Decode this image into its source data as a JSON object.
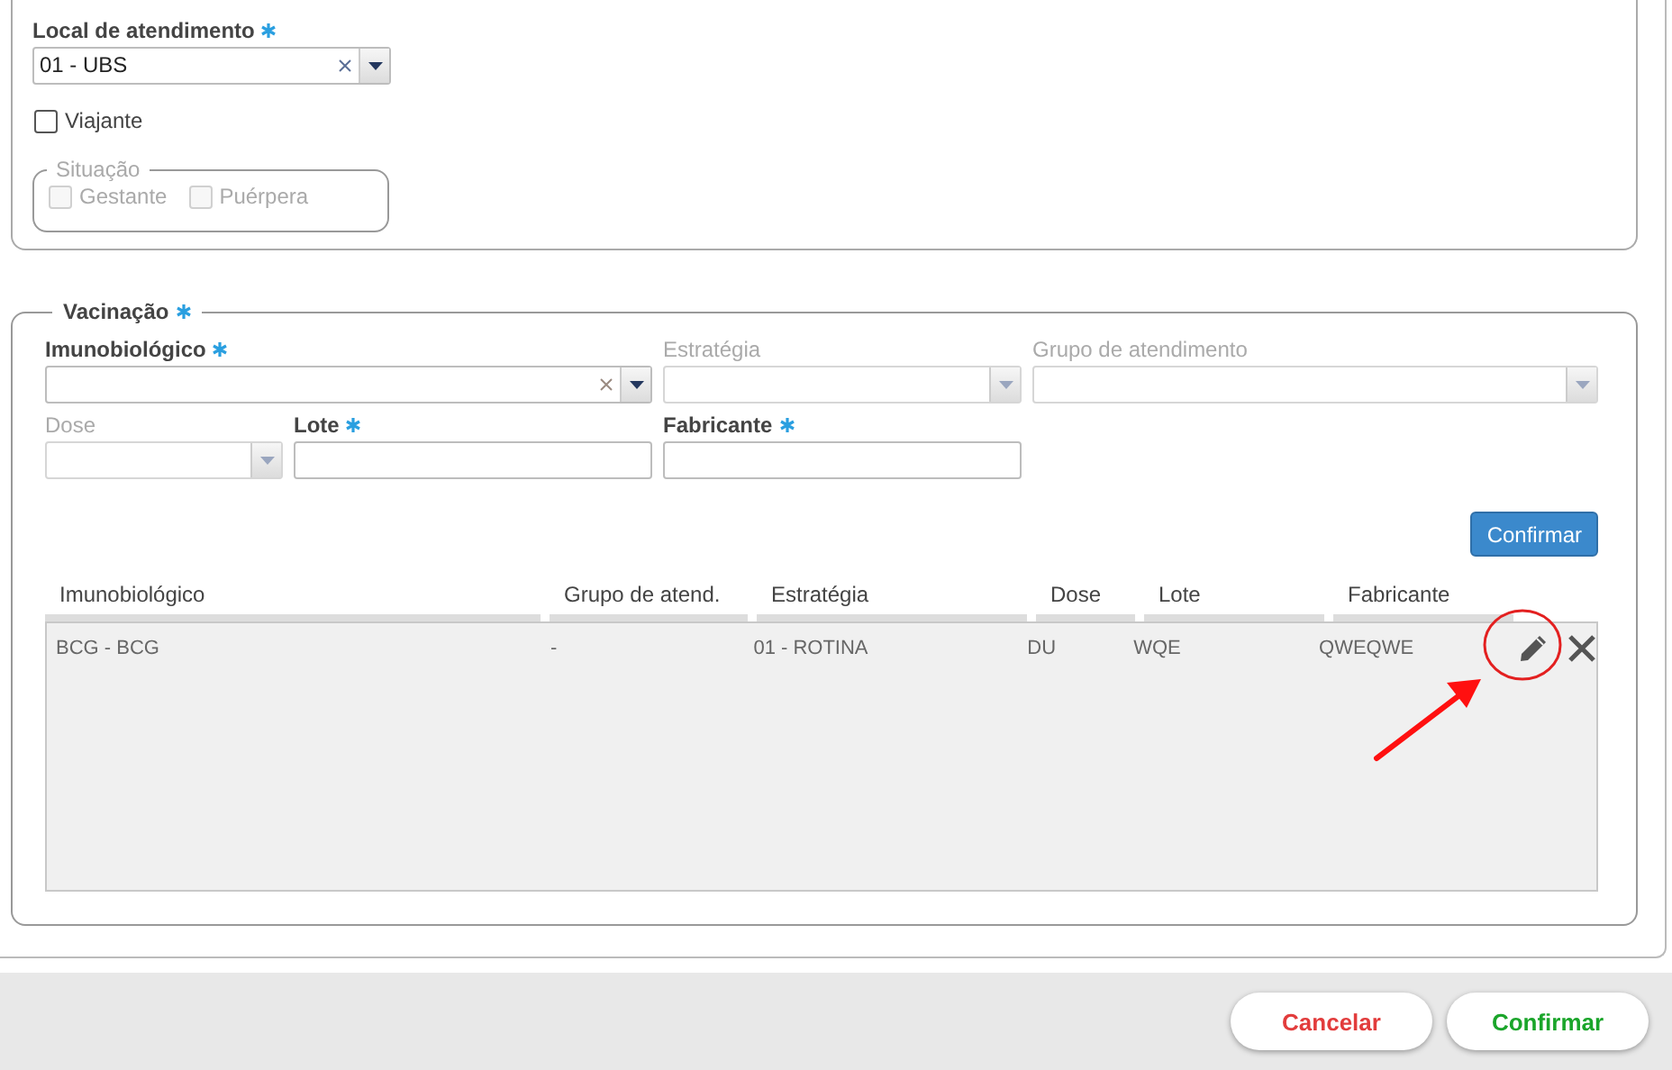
{
  "location_section": {
    "field": {
      "label": "Local de atendimento",
      "required": true,
      "value": "01 - UBS",
      "clearable": true,
      "disabled": false
    },
    "traveler": {
      "label": "Viajante",
      "checked": false,
      "disabled": false
    },
    "situation": {
      "legend": "Situação",
      "options": [
        {
          "label": "Gestante",
          "checked": false,
          "disabled": true
        },
        {
          "label": "Puérpera",
          "checked": false,
          "disabled": true
        }
      ]
    }
  },
  "vaccination": {
    "legend": "Vacinação",
    "required": true,
    "fields": [
      {
        "kind": "select",
        "label": "Imunobiológico",
        "required": true,
        "disabled": false,
        "clearable": true
      },
      {
        "kind": "select",
        "label": "Estratégia",
        "disabled": true
      },
      {
        "kind": "select",
        "label": "Grupo de atendimento",
        "disabled": true
      },
      {
        "kind": "select",
        "label": "Dose",
        "disabled": true
      },
      {
        "kind": "text",
        "label": "Lote",
        "required": true,
        "disabled": false
      },
      {
        "kind": "text",
        "label": "Fabricante",
        "required": true,
        "disabled": false
      }
    ],
    "add_button": "Confirmar",
    "table": {
      "columns": [
        "Imunobiológico",
        "Grupo de atend.",
        "Estratégia",
        "Dose",
        "Lote",
        "Fabricante"
      ],
      "rows": [
        {
          "cells": [
            "BCG - BCG",
            "-",
            "01 - ROTINA",
            "DU",
            "WQE",
            "QWEQWE"
          ]
        }
      ]
    }
  },
  "footer": {
    "buttons": [
      {
        "kind": "cancel",
        "label": "Cancelar"
      },
      {
        "kind": "confirm",
        "label": "Confirmar"
      }
    ]
  }
}
